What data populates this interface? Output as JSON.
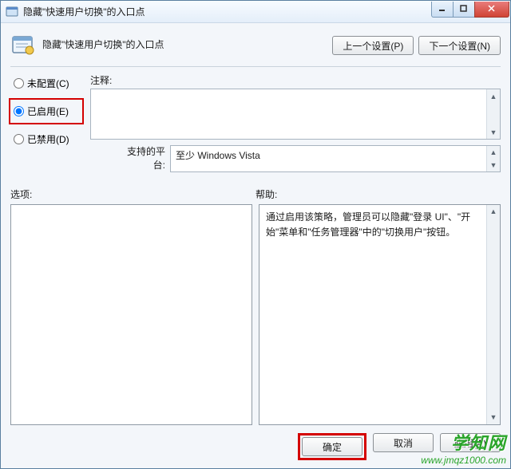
{
  "window": {
    "title": "隐藏\"快速用户切换\"的入口点"
  },
  "header": {
    "title": "隐藏\"快速用户切换\"的入口点",
    "prev_btn": "上一个设置(P)",
    "next_btn": "下一个设置(N)"
  },
  "radios": {
    "not_configured": "未配置(C)",
    "enabled": "已启用(E)",
    "disabled": "已禁用(D)",
    "selected": "enabled"
  },
  "comment": {
    "label": "注释:",
    "value": ""
  },
  "platform": {
    "label": "支持的平台:",
    "value": "至少 Windows Vista"
  },
  "sections": {
    "options_label": "选项:",
    "help_label": "帮助:"
  },
  "help": {
    "text": "通过启用该策略，管理员可以隐藏\"登录 UI\"、\"开始\"菜单和\"任务管理器\"中的\"切换用户\"按钮。"
  },
  "footer": {
    "ok": "确定",
    "cancel": "取消",
    "apply": "应用(A)"
  },
  "watermark": {
    "cn": "学知网",
    "url": "www.jmqz1000.com"
  }
}
